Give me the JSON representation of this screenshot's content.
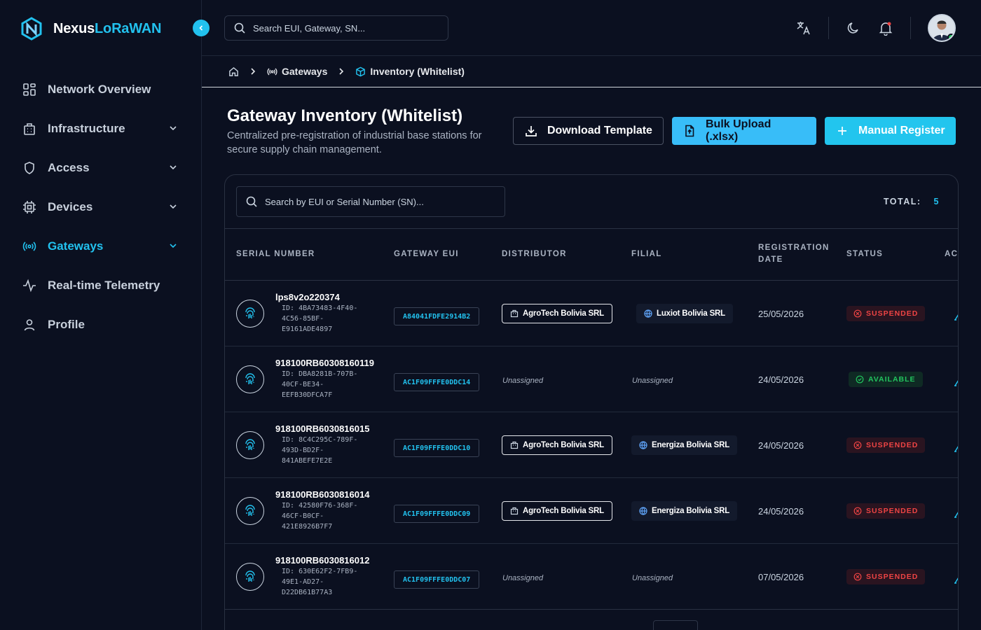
{
  "brand": {
    "name_primary": "Nexus",
    "name_accent": "LoRaWAN"
  },
  "sidebar": {
    "items": [
      {
        "label": "Network Overview",
        "icon": "grid-icon",
        "expandable": false,
        "active": false
      },
      {
        "label": "Infrastructure",
        "icon": "building-icon",
        "expandable": true,
        "active": false
      },
      {
        "label": "Access",
        "icon": "shield-icon",
        "expandable": true,
        "active": false
      },
      {
        "label": "Devices",
        "icon": "cpu-icon",
        "expandable": true,
        "active": false
      },
      {
        "label": "Gateways",
        "icon": "broadcast-icon",
        "expandable": true,
        "active": true
      },
      {
        "label": "Real-time Telemetry",
        "icon": "pulse-icon",
        "expandable": false,
        "active": false
      },
      {
        "label": "Profile",
        "icon": "user-icon",
        "expandable": false,
        "active": false
      }
    ]
  },
  "topbar": {
    "search_placeholder": "Search EUI, Gateway, SN...",
    "icons": [
      "translate-icon",
      "moon-icon",
      "bell-icon"
    ],
    "user_status": "online"
  },
  "breadcrumb": {
    "home_icon": "home-icon",
    "items": [
      {
        "label": "Gateways",
        "icon": "broadcast-icon"
      },
      {
        "label": "Inventory (Whitelist)",
        "icon": "box-icon"
      }
    ]
  },
  "header": {
    "title": "Gateway Inventory (Whitelist)",
    "description": "Centralized pre-registration of industrial base stations for secure supply chain management.",
    "buttons": {
      "download": "Download Template",
      "bulk": "Bulk Upload (.xlsx)",
      "manual": "Manual Register"
    }
  },
  "table": {
    "search_placeholder": "Search by EUI or Serial Number (SN)...",
    "total_label": "TOTAL:",
    "total_value": "5",
    "columns": {
      "serial": "SERIAL NUMBER",
      "eui": "GATEWAY EUI",
      "distributor": "DISTRIBUTOR",
      "filial": "FILIAL",
      "reg_line1": "REGISTRATION",
      "reg_line2": "DATE",
      "status": "STATUS",
      "actions": "ACTIONS"
    },
    "rows": [
      {
        "sn": "lps8v2o220374",
        "id": "ID: 4BA73483-4F40-4C56-85BF-E9161ADE4897",
        "eui": "A84041FDFE2914B2",
        "distributor": "AgroTech Bolivia SRL",
        "filial": "Luxiot Bolivia SRL",
        "date": "25/05/2026",
        "status": "SUSPENDED",
        "status_kind": "suspended"
      },
      {
        "sn": "918100RB60308160119",
        "id": "ID: DBA8281B-707B-40CF-BE34-EEFB30DFCA7F",
        "eui": "AC1F09FFFE0DDC14",
        "distributor": "Unassigned",
        "filial": "Unassigned",
        "date": "24/05/2026",
        "status": "AVAILABLE",
        "status_kind": "available"
      },
      {
        "sn": "918100RB6030816015",
        "id": "ID: 8C4C295C-789F-493D-BD2F-841ABEFE7E2E",
        "eui": "AC1F09FFFE0DDC10",
        "distributor": "AgroTech Bolivia SRL",
        "filial": "Energiza Bolivia SRL",
        "date": "24/05/2026",
        "status": "SUSPENDED",
        "status_kind": "suspended"
      },
      {
        "sn": "918100RB6030816014",
        "id": "ID: 42580F76-368F-46CF-B0CF-421E8926B7F7",
        "eui": "AC1F09FFFE0DDC09",
        "distributor": "AgroTech Bolivia SRL",
        "filial": "Energiza Bolivia SRL",
        "date": "24/05/2026",
        "status": "SUSPENDED",
        "status_kind": "suspended"
      },
      {
        "sn": "918100RB6030816012",
        "id": "ID: 630E62F2-7FB9-49E1-AD27-D22DB61B77A3",
        "eui": "AC1F09FFFE0DDC07",
        "distributor": "Unassigned",
        "filial": "Unassigned",
        "date": "07/05/2026",
        "status": "SUSPENDED",
        "status_kind": "suspended"
      }
    ]
  },
  "colors": {
    "accent": "#22c1ee",
    "background": "#0b1020",
    "danger": "#ef4444",
    "success": "#22c55e"
  }
}
